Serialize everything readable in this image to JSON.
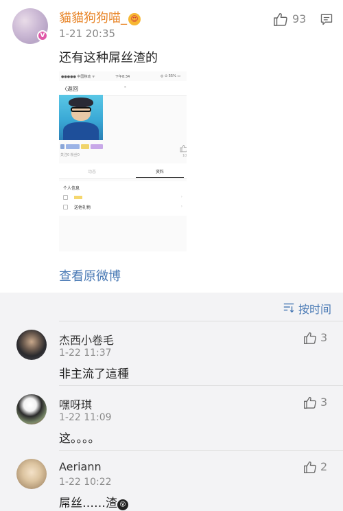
{
  "post": {
    "author": "貓貓狗狗喵_",
    "author_emoji": "😍",
    "verified_badge": "V",
    "time": "1-21 20:35",
    "like_count": "93",
    "text": "还有这种屌丝渣的",
    "view_original": "查看原微博",
    "embedded": {
      "carrier": "●●●●● 中国移动 ᯤ",
      "clock": "下午8:34",
      "battery": "◎ ⊙ 55% ▭",
      "back_label": "〈返回",
      "nav_title": "-",
      "fans_line": "关注0  粉丝0",
      "like_count": "10",
      "tab_left": "动态",
      "tab_right": "资料",
      "section_title": "个人信息",
      "row_gift_label": "送他礼物",
      "chevron": "›"
    }
  },
  "sort": {
    "label": "按时间"
  },
  "comments": [
    {
      "name": "杰西小卷毛",
      "time": "1-22 11:37",
      "text": "非主流了這種",
      "likes": "3"
    },
    {
      "name": "嘿呀琪",
      "time": "1-22 11:09",
      "text": "这。。。。",
      "likes": "3"
    },
    {
      "name": "Aeriann",
      "time": "1-22 10:22",
      "text": "屌丝……渣",
      "text_emoji": "😵",
      "likes": "2"
    }
  ],
  "colors": {
    "author_orange": "#e8862a",
    "link_blue": "#4a7ab5",
    "verified_pink": "#e058a8",
    "background": "#f3f3f5"
  }
}
